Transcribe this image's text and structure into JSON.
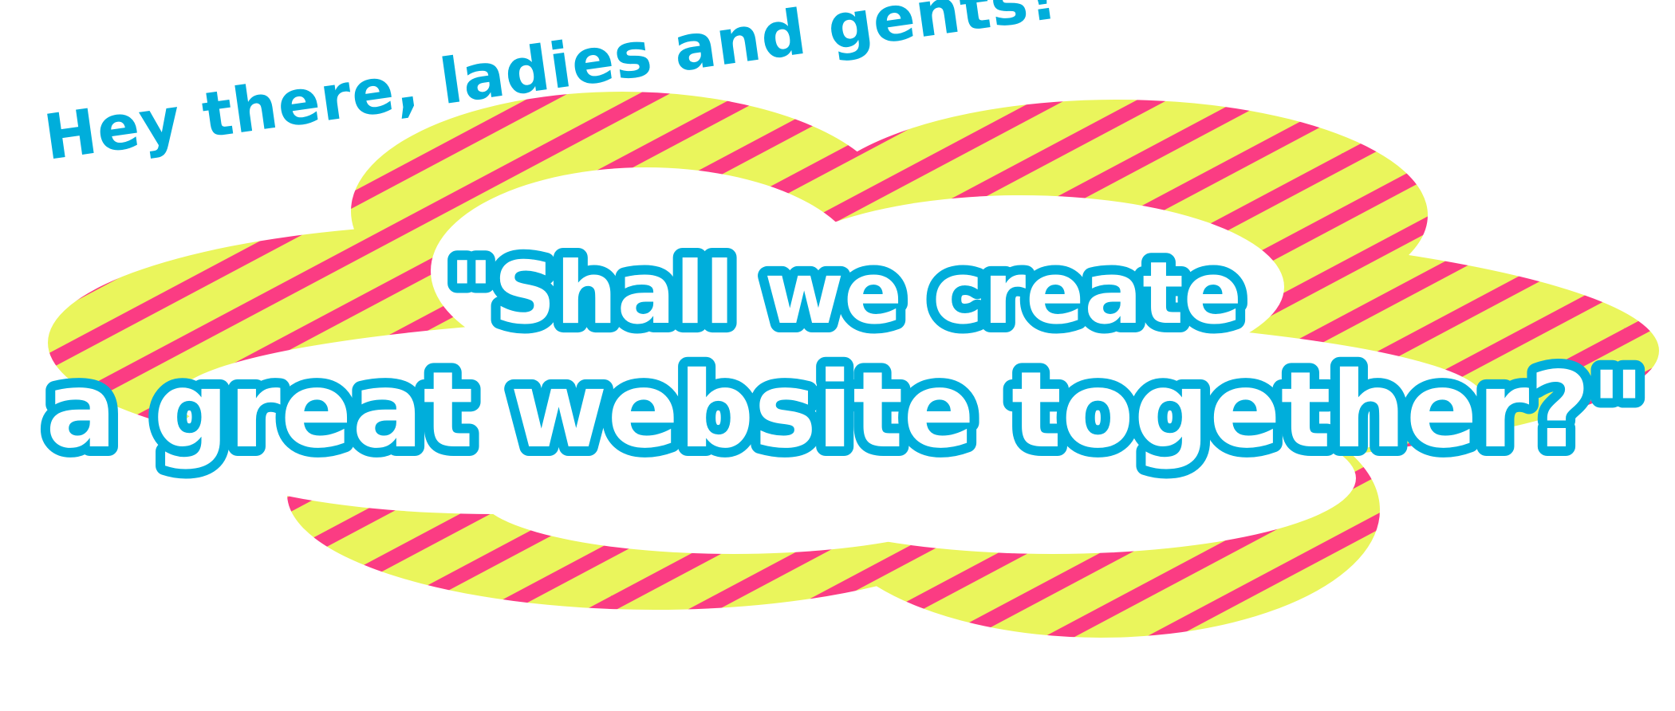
{
  "greeting": "Hey there, ladies and gents!",
  "headline": {
    "line1": "\"Shall we create",
    "line2": "a great website together?\""
  },
  "colors": {
    "stripe_pink": "#fb3c83",
    "stripe_yellow": "#eaf55c",
    "accent_blue": "#00aedb",
    "background": "#ffffff"
  }
}
